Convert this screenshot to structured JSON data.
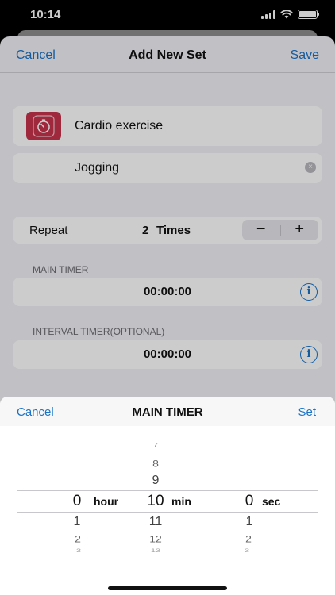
{
  "status": {
    "time": "10:14"
  },
  "nav": {
    "cancel": "Cancel",
    "title": "Add New Set",
    "save": "Save"
  },
  "exercise": {
    "category": "Cardio exercise",
    "name": "Jogging",
    "clear": "×"
  },
  "repeat": {
    "label": "Repeat",
    "count": "2",
    "unit": "Times",
    "minus": "−",
    "plus": "+"
  },
  "main_timer": {
    "label": "MAIN TIMER",
    "value": "00:00:00",
    "info": "i"
  },
  "interval_timer": {
    "label": "INTERVAL TIMER(OPTIONAL)",
    "value": "00:00:00",
    "info": "i"
  },
  "picker": {
    "cancel": "Cancel",
    "title": "MAIN TIMER",
    "set": "Set",
    "hour": {
      "unit": "hour",
      "selected": "0",
      "below": [
        "1",
        "2",
        "3"
      ]
    },
    "min": {
      "unit": "min",
      "above": [
        "7",
        "8",
        "9"
      ],
      "selected": "10",
      "below": [
        "11",
        "12",
        "13"
      ]
    },
    "sec": {
      "unit": "sec",
      "selected": "0",
      "below": [
        "1",
        "2",
        "3"
      ]
    }
  },
  "colors": {
    "accent": "#1a73c8",
    "cardio_icon": "#c8334d"
  },
  "icons": [
    "signal-icon",
    "wifi-icon",
    "battery-icon",
    "stopwatch-icon",
    "clear-icon",
    "info-icon"
  ]
}
